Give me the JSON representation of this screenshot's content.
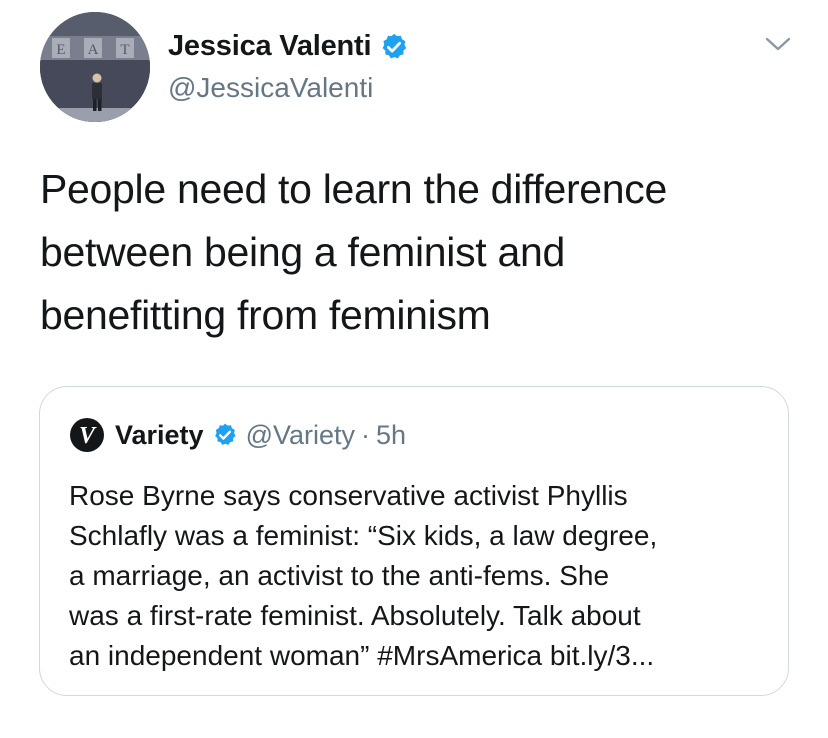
{
  "tweet": {
    "author_name": "Jessica Valenti",
    "author_handle": "@JessicaValenti",
    "avatar_sign_letters": [
      "E",
      "A",
      "T"
    ],
    "text": "People need to learn the difference\nbetween being a feminist and\nbenefitting from feminism",
    "icons": {
      "verified": "verified-badge-icon",
      "menu": "chevron-down-icon"
    },
    "colors": {
      "verified": "#1da1f2",
      "secondary_text": "#657786",
      "border": "#cfd9de"
    }
  },
  "quoted_tweet": {
    "author_name": "Variety",
    "author_handle": "@Variety",
    "separator": "·",
    "time": "5h",
    "logo_letter": "V",
    "text": "Rose Byrne says conservative activist Phyllis\nSchlafly was a feminist: “Six kids, a law degree,\na marriage, an activist to the anti-fems. She\nwas a first-rate feminist. Absolutely. Talk about\nan independent woman” #MrsAmerica bit.ly/3..."
  }
}
